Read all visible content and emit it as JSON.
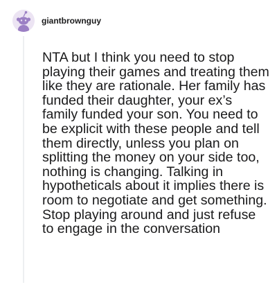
{
  "comment": {
    "author": {
      "username": "giantbrownguy",
      "avatar_icon": "snoo-avatar-icon",
      "avatar_bg": "#ece4f3",
      "avatar_accent": "#9b7fc4"
    },
    "body": "NTA but I think you need to stop playing their games and treating them like they are rationale. Her family has funded their daughter, your ex’s family funded your son. You need to be explicit with these people and tell them directly, unless you plan on splitting the money on your side too, nothing is changing. Talking in hypotheticals about it implies there is room to negotiate and get something. Stop playing around and just refuse to engage in the conversation"
  }
}
